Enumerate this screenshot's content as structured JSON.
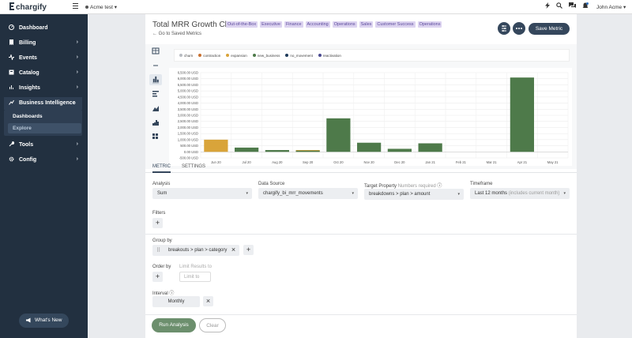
{
  "topbar": {
    "logo": "chargify",
    "site": "Acme test",
    "user": "John Acme",
    "icons": [
      "bolt-icon",
      "search-icon",
      "chat-icon",
      "notification-icon"
    ]
  },
  "sidebar": {
    "items": [
      {
        "label": "Dashboard",
        "icon": "dashboard-icon"
      },
      {
        "label": "Billing",
        "icon": "billing-icon"
      },
      {
        "label": "Events",
        "icon": "events-icon"
      },
      {
        "label": "Catalog",
        "icon": "catalog-icon"
      },
      {
        "label": "Insights",
        "icon": "insights-icon"
      },
      {
        "label": "Business Intelligence",
        "icon": "bi-icon"
      },
      {
        "label": "Tools",
        "icon": "tools-icon"
      },
      {
        "label": "Config",
        "icon": "config-icon"
      }
    ],
    "bi_sub": [
      {
        "label": "Dashboards"
      },
      {
        "label": "Explore"
      }
    ],
    "whats_new": "What's New"
  },
  "header": {
    "title": "Total MRR Growth Clone",
    "tags": [
      "Out-of-the-Box",
      "Executive",
      "Finance",
      "Accounting",
      "Operations",
      "Sales",
      "Customer Success",
      "Operations"
    ],
    "back_link": "Go to Saved Metrics",
    "save_label": "Save Metric"
  },
  "chart_data": {
    "type": "bar",
    "series_legend": [
      {
        "name": "churn",
        "color": "#b8bcc2"
      },
      {
        "name": "contraction",
        "color": "#c8702f"
      },
      {
        "name": "expansion",
        "color": "#d9a43a"
      },
      {
        "name": "new_business",
        "color": "#4e7a4a"
      },
      {
        "name": "no_movement",
        "color": "#1f3b5a"
      },
      {
        "name": "reactivation",
        "color": "#4a4a90"
      }
    ],
    "categories": [
      "Jun 20",
      "Jul 20",
      "Aug 20",
      "Sep 20",
      "Oct 20",
      "Nov 20",
      "Dec 20",
      "Jan 21",
      "Feb 21",
      "Mar 21",
      "Apr 21",
      "May 21"
    ],
    "y_ticks": [
      "6,500.00 USD",
      "6,000.00 USD",
      "5,500.00 USD",
      "5,000.00 USD",
      "4,500.00 USD",
      "4,000.00 USD",
      "3,500.00 USD",
      "3,000.00 USD",
      "2,500.00 USD",
      "2,000.00 USD",
      "1,500.00 USD",
      "1,000.00 USD",
      "500.00 USD",
      "0.00 USD",
      "-500.00 USD"
    ],
    "ylim": [
      -500,
      6500
    ],
    "series": [
      {
        "name": "expansion",
        "color": "#d9a43a",
        "values": [
          1000,
          0,
          0,
          150,
          0,
          0,
          0,
          0,
          0,
          0,
          0,
          0
        ]
      },
      {
        "name": "new_business",
        "color": "#4e7a4a",
        "values": [
          0,
          350,
          150,
          100,
          2750,
          750,
          250,
          700,
          0,
          0,
          6100,
          0
        ]
      }
    ],
    "grid": true
  },
  "tabs": [
    "METRIC",
    "SETTINGS"
  ],
  "form": {
    "analysis_label": "Analysis",
    "analysis_value": "Sum",
    "datasource_label": "Data Source",
    "datasource_value": "chargify_bi_mrr_movements",
    "target_label": "Target Property",
    "target_note": "Numbers required",
    "target_value": "breakdowns > plan > amount",
    "timeframe_label": "Timeframe",
    "timeframe_value": "Last 12 months",
    "timeframe_note": "(includes current month)",
    "filters_label": "Filters",
    "groupby_label": "Group by",
    "groupby_value": "breakouts > plan > category",
    "orderby_label": "Order by",
    "limit_label": "Limit Results to",
    "limit_placeholder": "Limit to",
    "interval_label": "Interval",
    "interval_value": "Monthly",
    "run_label": "Run Analysis",
    "clear_label": "Clear"
  }
}
